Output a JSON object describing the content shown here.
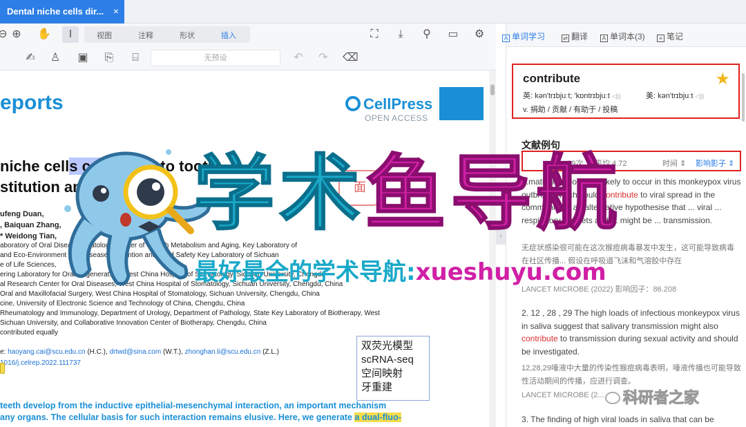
{
  "tab": {
    "title": "Dental niche cells dir...",
    "close": "×"
  },
  "toolbar": {
    "modes": [
      "视图",
      "注释",
      "形状",
      "插入"
    ],
    "active_mode": "插入",
    "preset_placeholder": "无预设"
  },
  "document": {
    "journal": "eports",
    "publisher": "CellPress",
    "open_access": "OPEN ACCESS",
    "title_line1_a": " niche cell",
    "title_line1_hl": "s contribut",
    "title_line1_b": "e to tooth",
    "title_line2": "stitution and regenesis",
    "authors1": "ufeng Duan,",
    "authors2": ", Baiquan Zhang,",
    "authors3": "* Weidong Tian,",
    "aff_lines": [
      "aboratory of Oral Disea...   ...matology, Center of Growth Metabolism and Aging, Key Laboratory of",
      "and Eco-Environment of ...      ...sease Prevention and Food Safety Key Laboratory of Sichuan",
      "e of Life Sciences,",
      "ering Laboratory for Oral Regenerat...   ...West China Hospital of Stomatology, Sichuan University, Chengdu",
      "al Research Center for Oral Diseases, West China Hospital of Stomatology, Sichuan University, Chengdu, China",
      "Oral and Maxillofacial Surgery, West China Hospital of Stomatology, Sichuan University, Chengdu, China",
      "cine, University of Electronic Science and Technology of China, Chengdu, China",
      "Rheumatology and Immunology, Department of Urology, Department of Pathology, State Key Laboratory of Biotherapy, West",
      "Sichuan University, and Collaborative Innovation Center of Biotherapy, Chengdu, China",
      "contributed equally"
    ],
    "contact_prefix": "e: ",
    "email1": "haoyang.cai@scu.edu.cn",
    "email1_name": " (H.C.), ",
    "email2": "drtwd@sina.com",
    "email2_name": " (W.T.), ",
    "email3": "zhonghan.li@scu.edu.cn",
    "email3_name": " (Z.L.)",
    "doi": "1016/j.celrep.2022.111737",
    "note_lines": [
      "双荧光模型",
      "scRNA-seq",
      "空间映射",
      "牙重建"
    ],
    "summary1": "teeth develop from the inductive epithelial-mesenchymal interaction, an important mechanism",
    "summary2_a": "any organs. The cellular basis for such interaction remains elusive. Here, we generate ",
    "summary2_hl": "a dual-fluo-",
    "stamp_text": "面"
  },
  "panel": {
    "tabs": [
      "单词学习",
      "翻译",
      "单词本(3)",
      "笔记"
    ],
    "word": "contribute",
    "uk_label": "英:",
    "uk_phon": "kən'trɪbjuːt; 'kɒntrɪbjuːt",
    "us_label": "美:",
    "us_phon": "kən'trɪbjuːt",
    "speaker": "◁))",
    "definition": "v. 捐助 / 贡献 / 有助于 / 投稿",
    "section_title": "文献例句",
    "sort_count": "39次",
    "sort_avg": "平均 4.72",
    "sort_time": "时间",
    "sort_if": "影响影子",
    "ex1_a": "...matic infections are likely to occur in this monkeypox virus outbreak which could ",
    "ex1_red": "contribute",
    "ex1_b": " to viral spread in the community ... an alternative hypothesise that ... viral ... respiratory droplets and ... might be ... transmission.",
    "ex1_cn": "无症状感染很可能在这次猴痘病毒暴发中发生，这可能导致病毒在社区传播... 假设在呼吸道飞沫和气溶胶中存在",
    "ex1_src": "LANCET MICROBE (2022) 影响因子：86.208",
    "ex2_a": "2. 12 , 28 , 29 The high loads of infectious monkeypox virus in saliva suggest that salivary transmission might also ",
    "ex2_red": "contribute",
    "ex2_b": " to transmission during sexual activity and should be investigated.",
    "ex2_cn": "12,28,29唾液中大量的传染性猴痘病毒表明，唾液传播也可能导致性活动期间的传播，应进行调查。",
    "ex2_src": "LANCET MICROBE (2...",
    "ex3": "3. The finding of high viral loads in saliva that can be"
  },
  "overlay": {
    "brand_main_1": "学术",
    "brand_main_2": "鱼导航",
    "brand_sub_1": "最好最全的学术导航:",
    "brand_sub_2": "xueshuyu.com",
    "wechat": "科研者之家"
  },
  "colors": {
    "accent": "#2d7ee6",
    "cell_blue": "#1a8fd6",
    "highlight_red": "#e02020",
    "brand_cyan": "#1aa9c9",
    "brand_magenta": "#d020a6"
  }
}
